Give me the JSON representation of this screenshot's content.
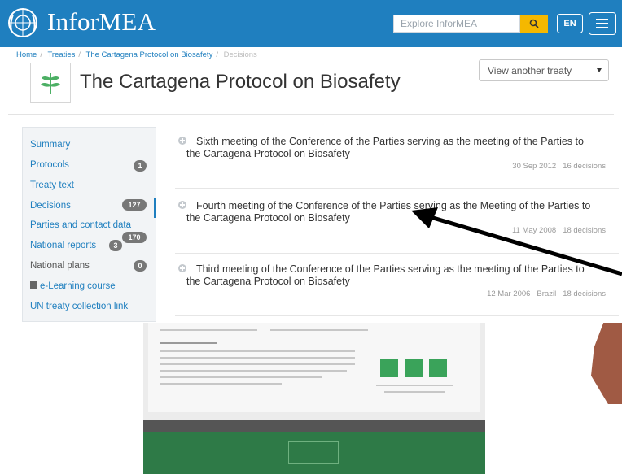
{
  "header": {
    "brand": "InforMEA",
    "search_placeholder": "Explore InforMEA",
    "language": "EN"
  },
  "breadcrumb": {
    "home": "Home",
    "treaties": "Treaties",
    "treaty": "The Cartagena Protocol on Biosafety",
    "current": "Decisions"
  },
  "page": {
    "title": "The Cartagena Protocol on Biosafety",
    "treaty_select": "View another treaty"
  },
  "sidebar": {
    "items": [
      {
        "label": "Summary",
        "badge": ""
      },
      {
        "label": "Protocols",
        "badge": "1"
      },
      {
        "label": "Treaty text",
        "badge": ""
      },
      {
        "label": "Decisions",
        "badge": "127"
      },
      {
        "label": "Parties and contact data",
        "badge": "170"
      },
      {
        "label": "National reports",
        "badge": "3"
      },
      {
        "label": "National plans",
        "badge": "0"
      },
      {
        "label": "e-Learning course",
        "badge": ""
      },
      {
        "label": "UN treaty collection link",
        "badge": ""
      }
    ]
  },
  "meetings": [
    {
      "title_line1": "Sixth meeting of the Conference of the Parties serving as the meeting of the Parties to",
      "title_line2": "the Cartagena Protocol on Biosafety",
      "date": "30 Sep 2012",
      "place": "",
      "decisions": "16 decisions"
    },
    {
      "title_line1": "Fourth meeting of the Conference of the Parties serving as the Meeting of the Parties to",
      "title_line2": "the Cartagena Protocol on Biosafety",
      "date": "11 May 2008",
      "place": "",
      "decisions": "18 decisions"
    },
    {
      "title_line1": "Third meeting of the Conference of the Parties serving as the meeting of the Parties to",
      "title_line2": "the Cartagena Protocol on Biosafety",
      "date": "12 Mar 2006",
      "place": "Brazil",
      "decisions": "18 decisions"
    }
  ],
  "colors": {
    "brand_blue": "#1f7fbf",
    "search_yellow": "#f5b800"
  }
}
